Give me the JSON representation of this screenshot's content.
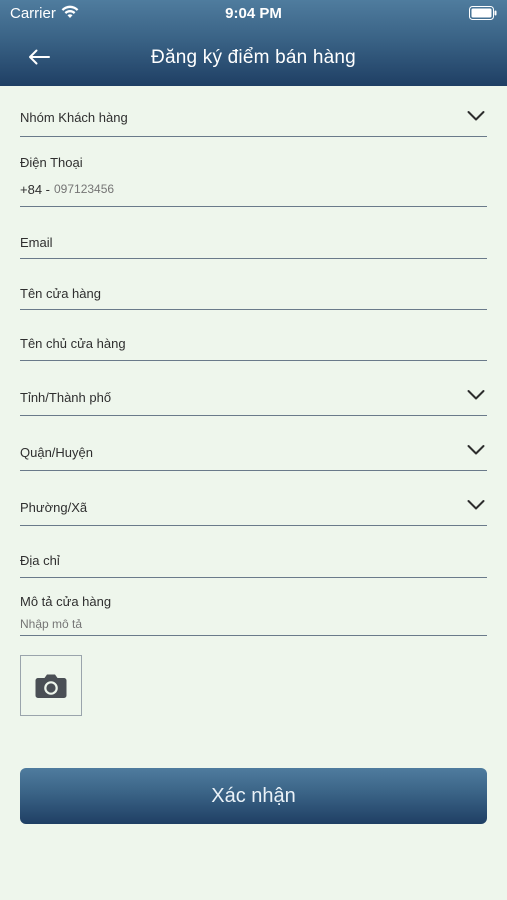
{
  "status_bar": {
    "carrier": "Carrier",
    "time": "9:04 PM"
  },
  "nav": {
    "title": "Đăng ký điểm bán hàng"
  },
  "form": {
    "customer_group_label": "Nhóm Khách hàng",
    "phone_label": "Điện Thoại",
    "phone_prefix": "+84 -",
    "phone_placeholder": "097123456",
    "email_label": "Email",
    "store_name_label": "Tên cửa hàng",
    "owner_name_label": "Tên chủ cửa hàng",
    "province_label": "Tỉnh/Thành phố",
    "district_label": "Quận/Huyện",
    "ward_label": "Phường/Xã",
    "address_label": "Địa chỉ",
    "description_label": "Mô tả cửa hàng",
    "description_placeholder": "Nhập mô tả"
  },
  "submit_label": "Xác nhận",
  "colors": {
    "header_top": "#4f7c9e",
    "header_bottom": "#1f3f64",
    "background": "#eef6ec"
  }
}
